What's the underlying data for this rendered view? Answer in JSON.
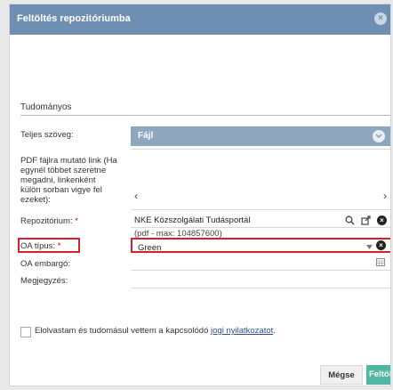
{
  "dialog": {
    "title": "Feltöltés repozitóriumba",
    "close_glyph": "×"
  },
  "section": {
    "heading": "Tudományos"
  },
  "fields": {
    "full_text": {
      "label": "Teljes szöveg:",
      "button_label": "Fájl",
      "button_icon": "chevron-down-icon"
    },
    "pdf_link": {
      "label_lines": [
        "PDF fájlra mutató link (Ha",
        "egynél többet szeretne",
        "megadni, linkenként",
        "külön sorban vigye fel",
        "ezeket):"
      ],
      "prev_glyph": "‹",
      "next_glyph": "›"
    },
    "repository": {
      "label": "Repozitórium:",
      "required_mark": "*",
      "value": "NKE Közszolgálati Tudásportál",
      "subtext": "(pdf - max: 104857600)",
      "icons": [
        "search-icon",
        "external-link-icon",
        "clear-icon"
      ]
    },
    "oa_type": {
      "label": "OA típus:",
      "required_mark": "*",
      "value": "Green",
      "highlight_color": "#d6202c"
    },
    "oa_embargo": {
      "label": "OA embargó:",
      "icon": "calendar-icon"
    },
    "note": {
      "label": "Megjegyzés:"
    }
  },
  "consent": {
    "text": "Elolvastam és tudomásul vettem a kapcsolódó ",
    "link": "jogi nyilatkozatot",
    "suffix": "."
  },
  "footer": {
    "cancel_label": "Mégse",
    "upload_label": "Feltölt"
  },
  "colors": {
    "titlebar": "#6e8fb1",
    "file_bar": "#8ea7bf",
    "upload": "#52b7a2"
  }
}
